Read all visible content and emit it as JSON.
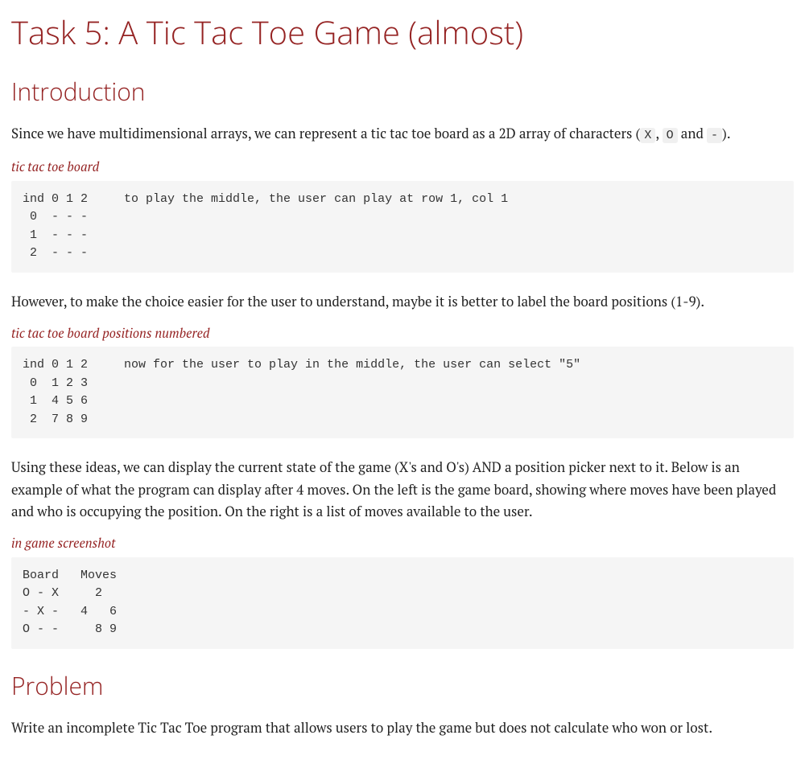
{
  "title": "Task 5: A Tic Tac Toe Game (almost)",
  "sections": {
    "intro": {
      "heading": "Introduction",
      "p1_pre": "Since we have multidimensional arrays, we can represent a tic tac toe board as a 2D array of characters (",
      "code_x": "X",
      "sep1": ", ",
      "code_o": "O",
      "sep2": " and ",
      "code_dash": "-",
      "p1_post": ").",
      "listing1_title": "tic tac toe board",
      "listing1_code": "ind 0 1 2     to play the middle, the user can play at row 1, col 1\n 0  - - -\n 1  - - -\n 2  - - -",
      "p2": "However, to make the choice easier for the user to understand, maybe it is better to label the board positions (1-9).",
      "listing2_title": "tic tac toe board positions numbered",
      "listing2_code": "ind 0 1 2     now for the user to play in the middle, the user can select \"5\"\n 0  1 2 3\n 1  4 5 6\n 2  7 8 9",
      "p3": "Using these ideas, we can display the current state of the game (X's and O's) AND a position picker next to it. Below is an example of what the program can display after 4 moves. On the left is the game board, showing where moves have been played and who is occupying the position. On the right is a list of moves available to the user.",
      "listing3_title": "in game screenshot",
      "listing3_code": "Board   Moves\nO - X     2\n- X -   4   6\nO - -     8 9"
    },
    "problem": {
      "heading": "Problem",
      "p1": "Write an incomplete Tic Tac Toe program that allows users to play the game but does not calculate who won or lost."
    }
  }
}
